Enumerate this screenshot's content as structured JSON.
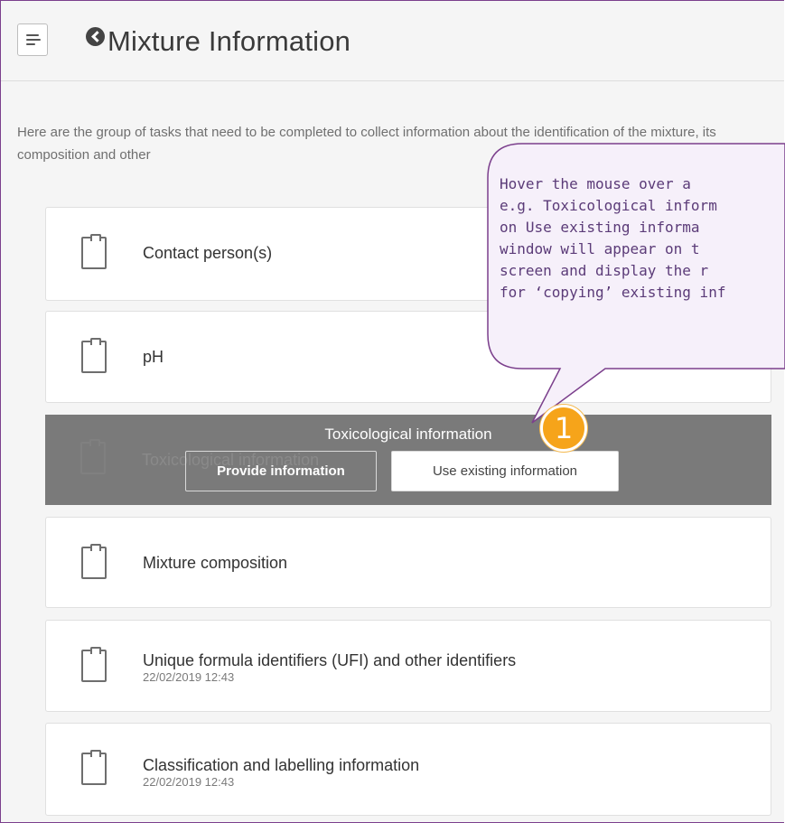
{
  "header": {
    "title": "Mixture Information"
  },
  "intro": "Here are the group of tasks that need to be completed to collect information about the identification of the mixture, its composition and other",
  "tasks": [
    {
      "label": "Contact person(s)",
      "date": ""
    },
    {
      "label": "pH",
      "date": ""
    },
    {
      "label": "Toxicological information",
      "date": ""
    },
    {
      "label": "Mixture composition",
      "date": ""
    },
    {
      "label": "Unique formula identifiers (UFI) and other identifiers",
      "date": "22/02/2019 12:43"
    },
    {
      "label": "Classification and labelling information",
      "date": "22/02/2019 12:43"
    }
  ],
  "hover": {
    "title": "Toxicological information",
    "provide_label": "Provide information",
    "use_label": "Use existing information"
  },
  "callout": {
    "lines": [
      "Hover the mouse over a",
      "e.g. Toxicological inform",
      "on Use existing informa",
      "window will appear on t",
      "screen and display the r",
      "for ‘copying’ existing inf"
    ],
    "badge": "1"
  },
  "colors": {
    "accent_border": "#7b3f8c",
    "callout_bg": "#f6f0fa",
    "callout_text": "#5b3b78",
    "badge": "#f6a41a",
    "hover_card_bg": "#7a7a7a"
  },
  "icons": {
    "menu": "menu-icon",
    "back": "back-arrow-icon",
    "task": "clipboard-icon"
  }
}
